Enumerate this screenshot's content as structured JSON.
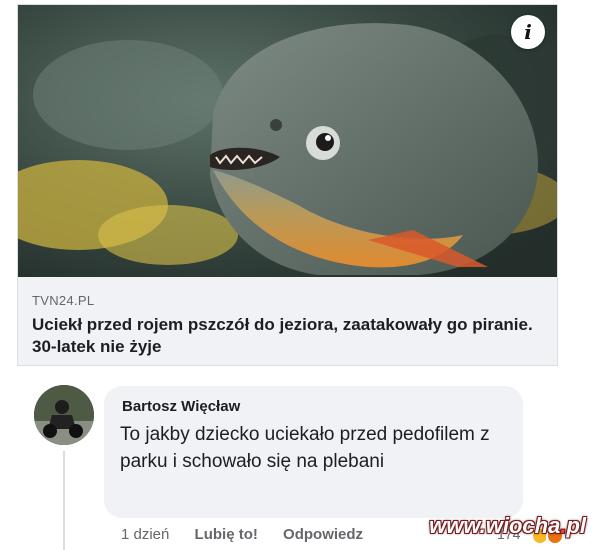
{
  "post": {
    "image": {
      "description": "piranha photo",
      "info_icon": "info-icon"
    },
    "link_preview": {
      "source": "TVN24.PL",
      "headline": "Uciekł przed rojem pszczół do jeziora, zaatakowały go piranie. 30-latek nie żyje"
    }
  },
  "comment": {
    "author": "Bartosz Więcław",
    "text": "To jakby dziecko uciekało przed pedofilem z parku i schowało się na plebani",
    "time": "1 dzień",
    "like_label": "Lubię to!",
    "reply_label": "Odpowiedz",
    "reaction_count": "174",
    "reactions": [
      "haha",
      "angry"
    ]
  },
  "watermark": {
    "prefix": "www.",
    "name": "wiocha",
    "dot": ".",
    "tld": "pl"
  },
  "colors": {
    "card_bg": "#f0f2f5",
    "muted_text": "#65676b",
    "primary_text": "#1c1e21"
  }
}
